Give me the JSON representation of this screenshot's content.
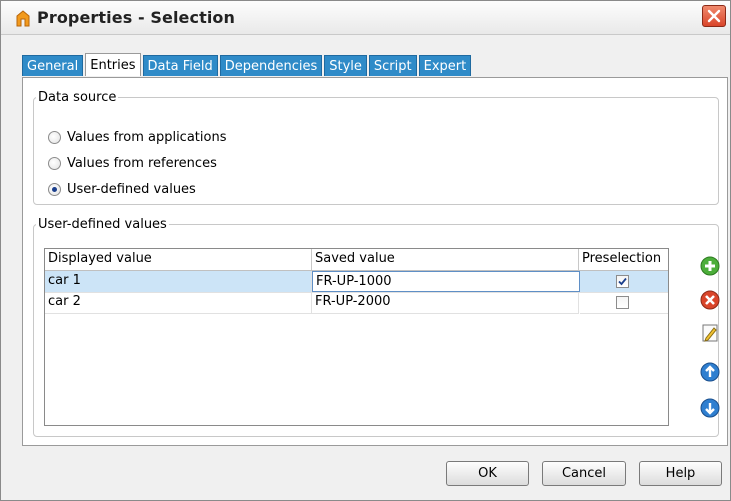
{
  "window": {
    "title": "Properties - Selection"
  },
  "tabs": [
    {
      "label": "General"
    },
    {
      "label": "Entries",
      "active": true
    },
    {
      "label": "Data Field"
    },
    {
      "label": "Dependencies"
    },
    {
      "label": "Style"
    },
    {
      "label": "Script"
    },
    {
      "label": "Expert"
    }
  ],
  "data_source": {
    "legend": "Data source",
    "options": [
      {
        "label": "Values from applications",
        "checked": false
      },
      {
        "label": "Values from references",
        "checked": false
      },
      {
        "label": "User-defined values",
        "checked": true
      }
    ]
  },
  "user_defined": {
    "legend": "User-defined values",
    "columns": [
      "Displayed value",
      "Saved value",
      "Preselection"
    ],
    "rows": [
      {
        "displayed": "car 1",
        "saved": "FR-UP-1000",
        "preselection": true
      },
      {
        "displayed": "car 2",
        "saved": "FR-UP-2000",
        "preselection": false
      }
    ],
    "side_buttons": [
      "add-icon",
      "remove-icon",
      "edit-icon",
      "move-up-icon",
      "move-down-icon"
    ]
  },
  "footer": {
    "ok_label": "OK",
    "cancel_label": "Cancel",
    "help_label": "Help"
  },
  "colors": {
    "tab_blue": "#2f8bc8",
    "selection": "#cce4f7",
    "close_red": "#d9452a"
  }
}
